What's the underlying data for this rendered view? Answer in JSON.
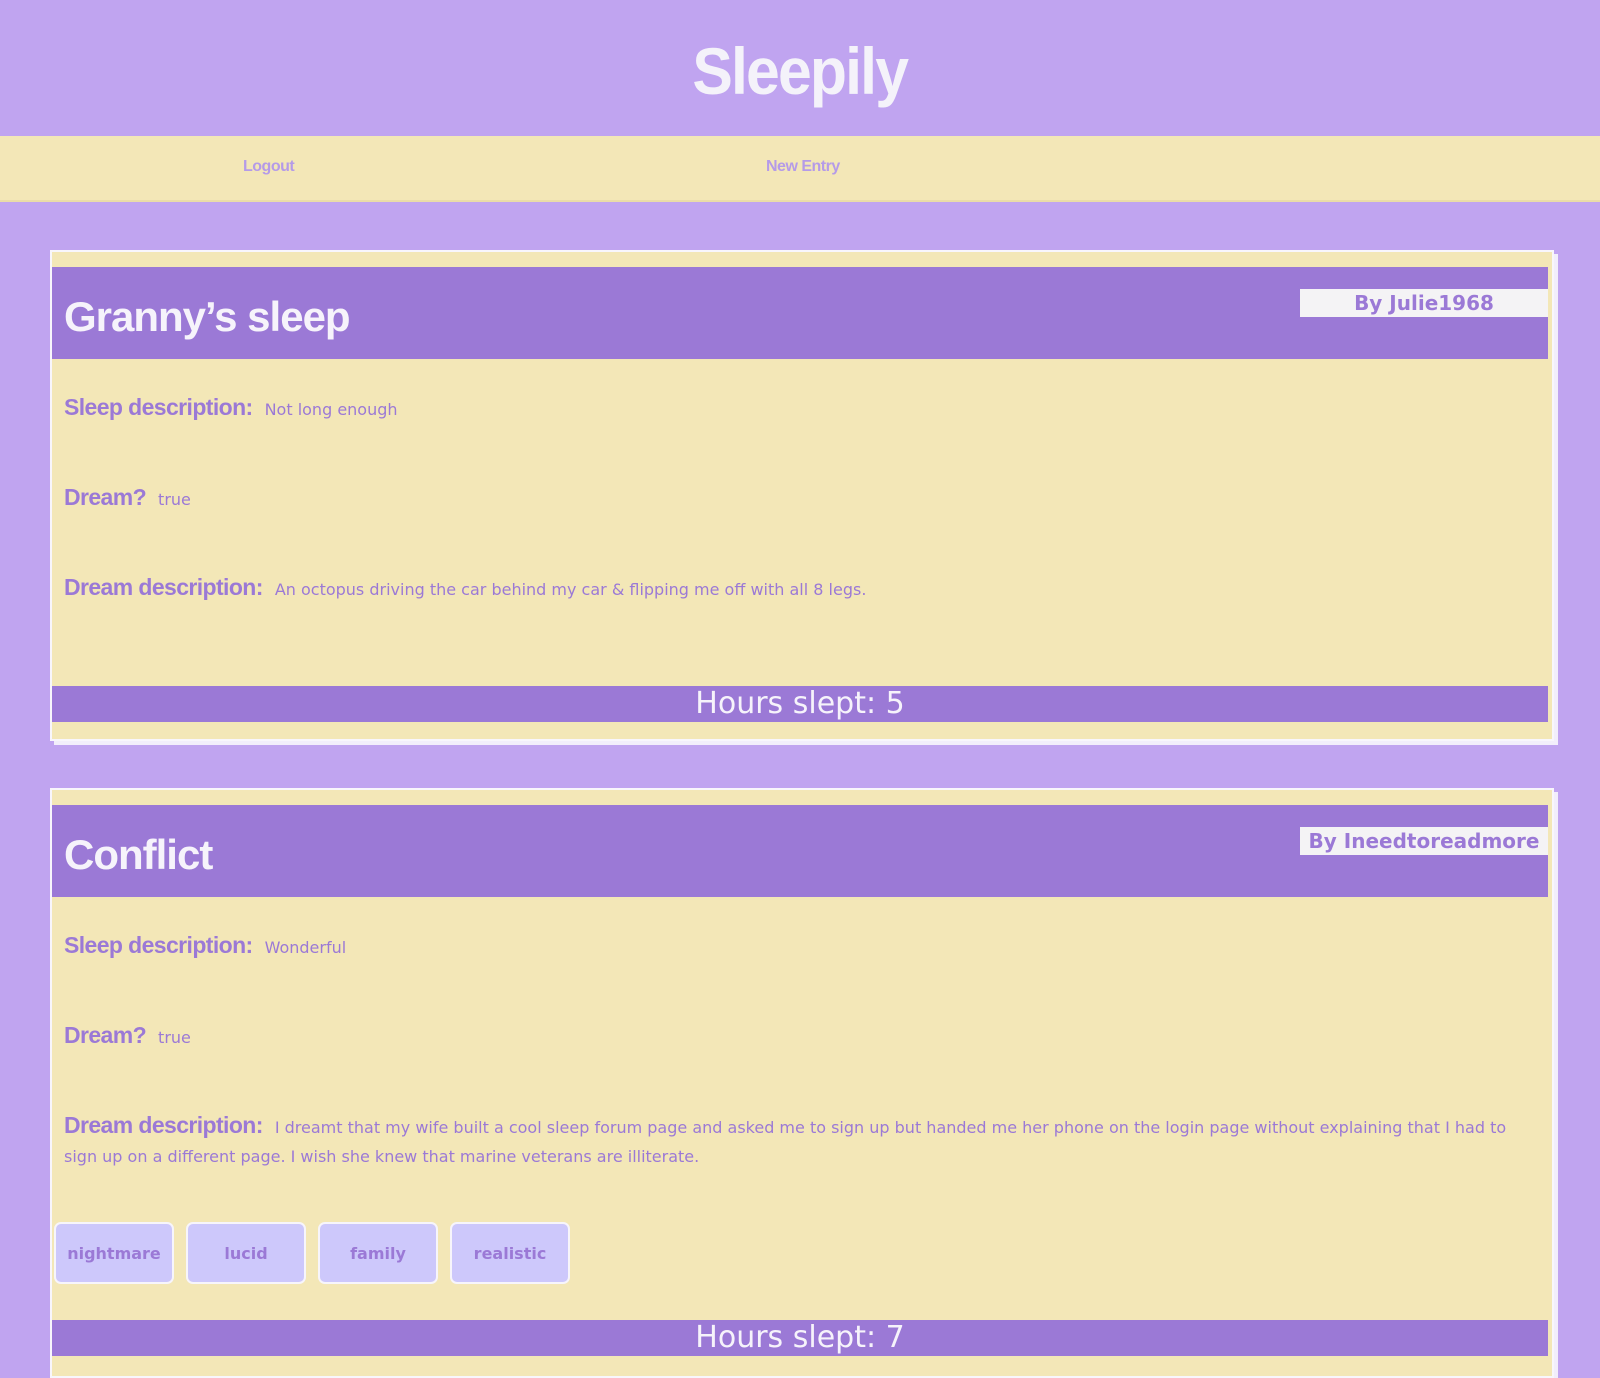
{
  "site": {
    "title": "Sleepily"
  },
  "nav": {
    "logout": "Logout",
    "new_entry": "New Entry"
  },
  "labels": {
    "sleep_description": "Sleep description:",
    "dream": "Dream?",
    "dream_description": "Dream description:"
  },
  "entries": [
    {
      "title": "Granny’s sleep",
      "author": "By Julie1968",
      "sleep_description": "Not long enough",
      "dream": "true",
      "dream_description": "An octopus driving the car behind my car & flipping me off with all 8 legs.",
      "tags": [],
      "hours": "Hours slept: 5"
    },
    {
      "title": "Conflict",
      "author": "By Ineedtoreadmore",
      "sleep_description": "Wonderful",
      "dream": "true",
      "dream_description": "I dreamt that my wife built a cool sleep forum page and asked me to sign up but handed me her phone on the login page without explaining that I had to sign up on a different page. I wish she knew that marine veterans are illiterate.",
      "tags": [
        "nightmare",
        "lucid",
        "family",
        "realistic"
      ],
      "hours": "Hours slept: 7"
    }
  ],
  "colors": {
    "background": "#c0a4f0",
    "cream": "#f3e7b7",
    "purple": "#9b79d6",
    "tag": "#cdc8fb"
  }
}
